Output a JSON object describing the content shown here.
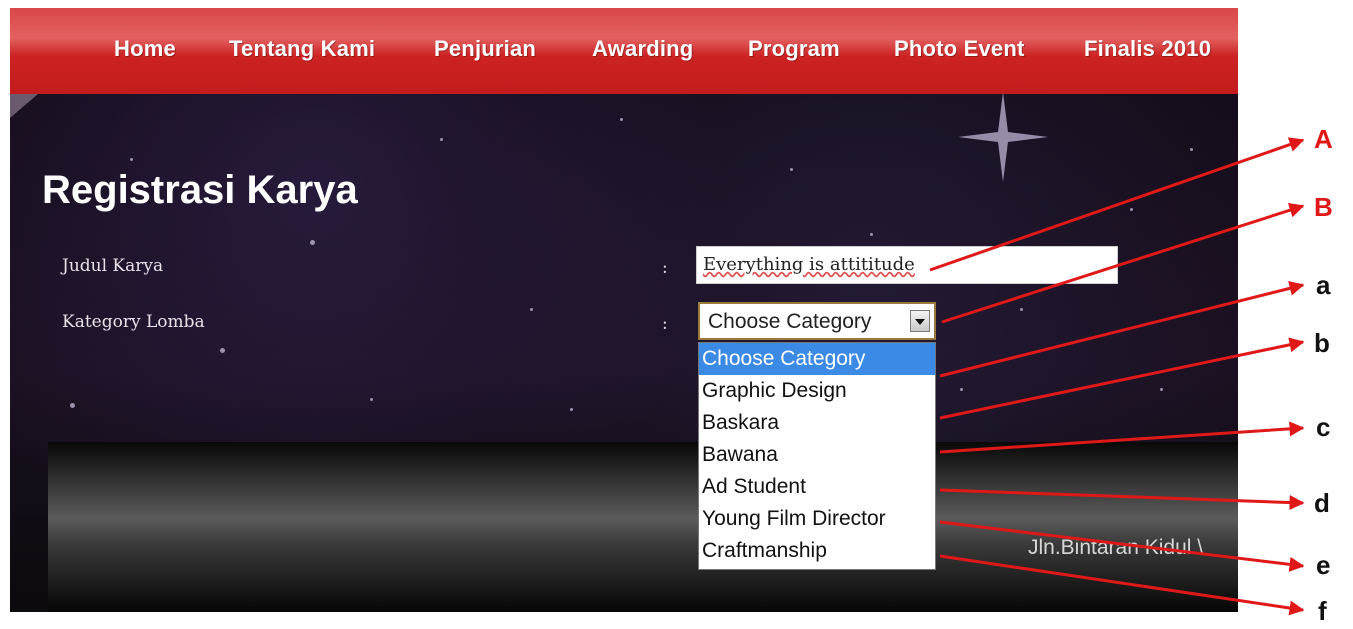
{
  "nav": {
    "items": [
      "Home",
      "Tentang Kami",
      "Penjurian",
      "Awarding",
      "Program",
      "Photo Event",
      "Finalis 2010"
    ]
  },
  "page": {
    "title": "Registrasi Karya"
  },
  "form": {
    "title_label": "Judul Karya",
    "title_value": "Everything is attititude",
    "category_label": "Kategory Lomba",
    "colon": ":",
    "category_selected": "Choose Category",
    "category_options": [
      "Choose Category",
      "Graphic Design",
      "Baskara",
      "Bawana",
      "Ad Student",
      "Young Film Director",
      "Craftmanship"
    ]
  },
  "footer": {
    "address": "Jln.Bintaran Kidul \\"
  },
  "annotations": {
    "labels": [
      "A",
      "B",
      "a",
      "b",
      "c",
      "d",
      "e",
      "f"
    ]
  },
  "colors": {
    "nav_red": "#cc2222",
    "annotation_red": "#e01818",
    "selected_option": "#3a8ae6"
  }
}
